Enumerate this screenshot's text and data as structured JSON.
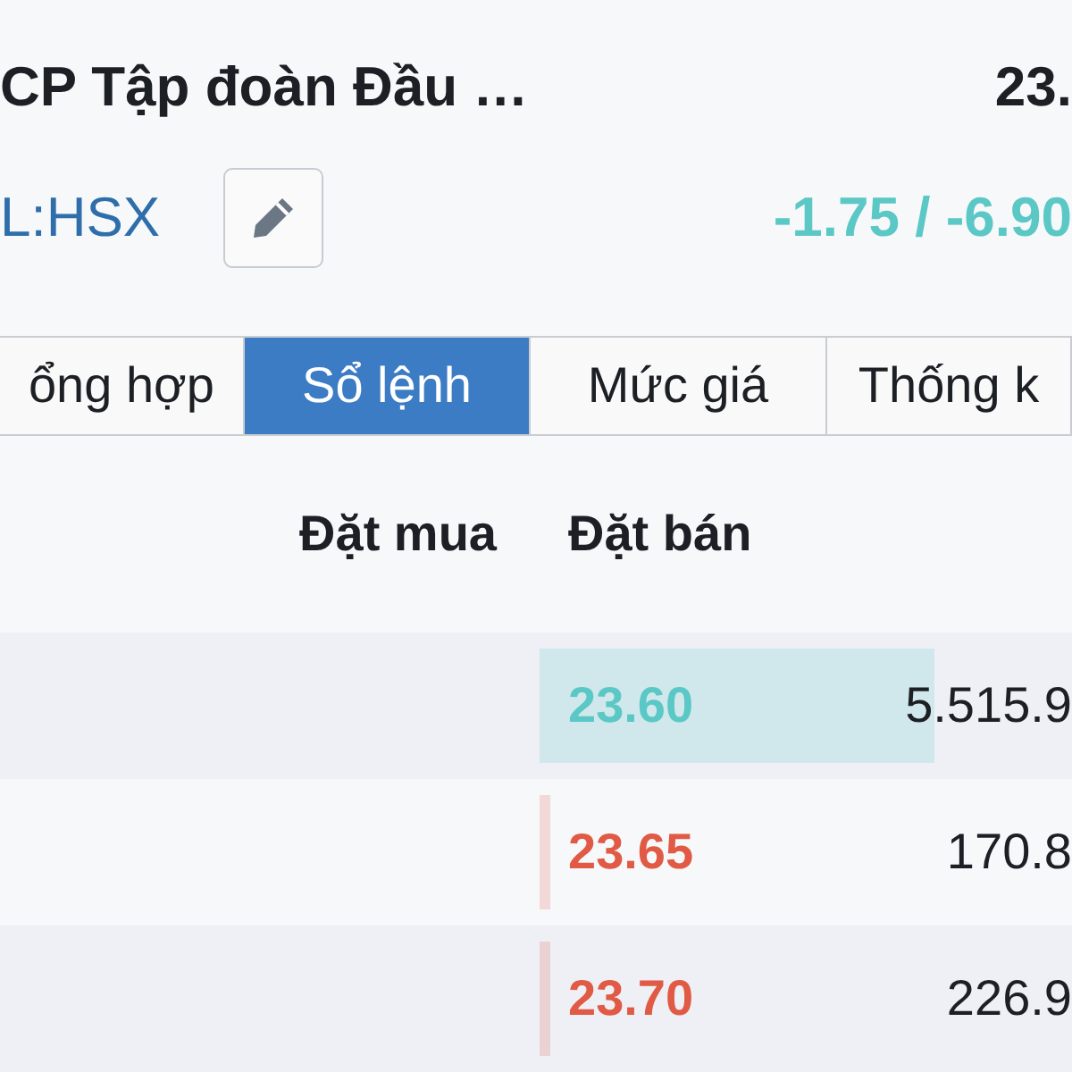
{
  "header": {
    "name": "CP Tập đoàn Đầu …",
    "price": "23.",
    "symbol": "L:HSX",
    "change": "-1.75 / -6.90"
  },
  "tabs": [
    {
      "label": "ổng hợp",
      "selected": false
    },
    {
      "label": "Sổ lệnh",
      "selected": true
    },
    {
      "label": "Mức giá",
      "selected": false
    },
    {
      "label": "Thống k",
      "selected": false
    }
  ],
  "book": {
    "columns": [
      "Đặt mua",
      "Đặt bán"
    ],
    "rows": [
      {
        "price": "23.60",
        "color": "#5bc8c6",
        "volume": "5.515.9",
        "level": 0.74
      },
      {
        "price": "23.65",
        "color": "#e05a45",
        "volume": "170.8"
      },
      {
        "price": "23.70",
        "color": "#e05a45",
        "volume": "226.9"
      }
    ]
  }
}
